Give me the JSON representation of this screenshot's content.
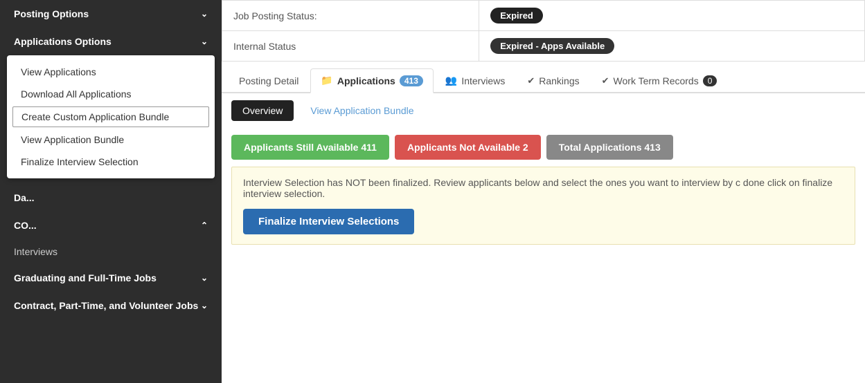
{
  "sidebar": {
    "posting_options_label": "Posting Options",
    "applications_options_label": "Applications Options",
    "menu_items": [
      {
        "id": "view-applications",
        "label": "View Applications",
        "active": false
      },
      {
        "id": "download-all",
        "label": "Download All Applications",
        "active": false
      },
      {
        "id": "create-custom",
        "label": "Create Custom Application Bundle",
        "active": true
      },
      {
        "id": "view-bundle",
        "label": "View Application Bundle",
        "active": false
      },
      {
        "id": "finalize-interview",
        "label": "Finalize Interview Selection",
        "active": false
      }
    ],
    "nav_items": [
      {
        "id": "dashboard",
        "label": "Da...",
        "has_chevron": false
      },
      {
        "id": "co",
        "label": "CO...",
        "has_chevron": true
      },
      {
        "id": "interviews",
        "label": "Interviews",
        "has_chevron": false
      },
      {
        "id": "graduating-jobs",
        "label": "Graduating and Full-Time Jobs",
        "has_chevron": true
      },
      {
        "id": "contract-jobs",
        "label": "Contract, Part-Time, and Volunteer Jobs",
        "has_chevron": true
      }
    ]
  },
  "main": {
    "status_section": {
      "job_posting_status_label": "Job Posting Status:",
      "job_posting_status_value": "Expired",
      "internal_status_label": "Internal Status",
      "internal_status_value": "Expired - Apps Available"
    },
    "tabs": [
      {
        "id": "posting-detail",
        "label": "Posting Detail",
        "badge": null,
        "active": false
      },
      {
        "id": "applications",
        "label": "Applications",
        "badge": "413",
        "active": true
      },
      {
        "id": "interviews",
        "label": "Interviews",
        "badge": null,
        "active": false
      },
      {
        "id": "rankings",
        "label": "Rankings",
        "badge": null,
        "active": false
      },
      {
        "id": "work-term-records",
        "label": "Work Term Records",
        "badge": "0",
        "active": false
      }
    ],
    "sub_nav": [
      {
        "id": "overview",
        "label": "Overview",
        "active": true
      },
      {
        "id": "view-bundle",
        "label": "View Application Bundle",
        "active": false
      }
    ],
    "stats": [
      {
        "id": "still-available",
        "label": "Applicants Still Available 411",
        "color": "green"
      },
      {
        "id": "not-available",
        "label": "Applicants Not Available 2",
        "color": "red"
      },
      {
        "id": "total",
        "label": "Total Applications 413",
        "color": "gray"
      }
    ],
    "notice": {
      "text": "Interview Selection has NOT been finalized. Review applicants below and select the ones you want to interview by c done click on finalize interview selection."
    },
    "finalize_button_label": "Finalize Interview Selections"
  }
}
